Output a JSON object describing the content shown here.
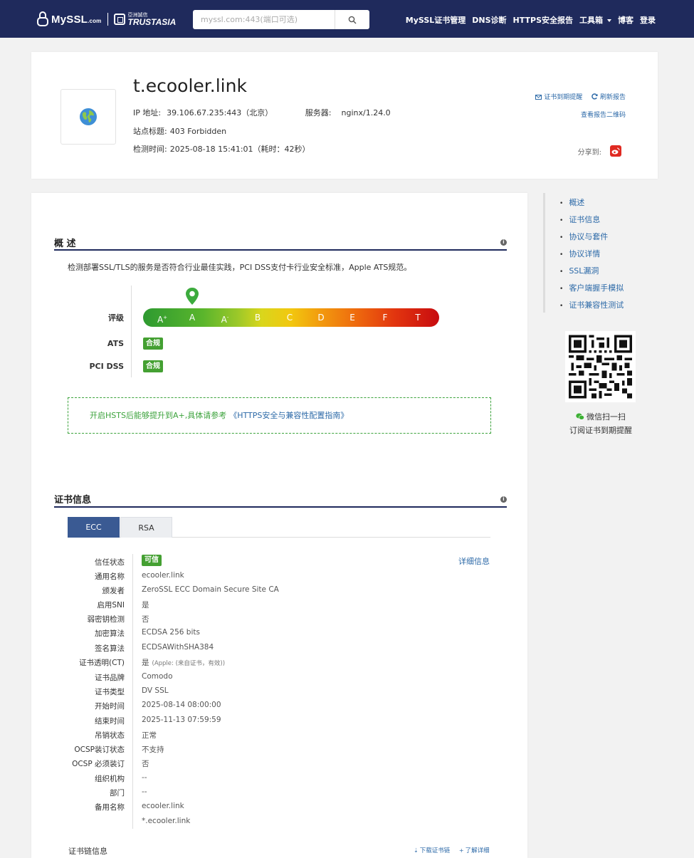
{
  "nav": {
    "brand": "MySSL",
    "brand_suffix": ".com",
    "partner_cn": "亞洲誠信",
    "partner_en": "TRUSTASIA",
    "search_placeholder": "myssl.com:443(端口可选)",
    "items": [
      "MySSL证书管理",
      "DNS诊断",
      "HTTPS安全报告",
      "工具箱",
      "博客",
      "登录"
    ]
  },
  "header": {
    "domain": "t.ecooler.link",
    "ip_label": "IP 地址:",
    "ip_value": "39.106.67.235:443（北京）",
    "server_label": "服务器:",
    "server_value": "nginx/1.24.0",
    "title_label": "站点标题:",
    "title_value": "403 Forbidden",
    "time_label": "检测时间:",
    "time_value": "2025-08-18 15:41:01（耗时：42秒）",
    "action_remind": "证书到期提醒",
    "action_refresh": "刷新报告",
    "action_qr": "查看报告二维码",
    "share_label": "分享到:"
  },
  "overview": {
    "title": "概 述",
    "desc": "检测部署SSL/TLS的服务是否符合行业最佳实践，PCI DSS支付卡行业安全标准，Apple ATS规范。",
    "grade_label": "评级",
    "grades": [
      "A",
      "A",
      "A",
      "B",
      "C",
      "D",
      "E",
      "F",
      "T"
    ],
    "grade_marks": [
      "+",
      "",
      "-",
      "",
      "",
      "",
      "",
      "",
      ""
    ],
    "current_grade": "A",
    "ats_label": "ATS",
    "ats_value": "合规",
    "pci_label": "PCI DSS",
    "pci_value": "合规",
    "hsts_text": "开启HSTS后能够提升到A+,具体请参考",
    "hsts_link": "《HTTPS安全与兼容性配置指南》",
    "colors": {
      "grade_ok": "#44a032",
      "nav_bg": "#1f2a5c",
      "link": "#2d6aa8"
    }
  },
  "cert": {
    "title": "证书信息",
    "tabs": [
      "ECC",
      "RSA"
    ],
    "active_tab": "ECC",
    "detail_link": "详细信息",
    "rows": [
      {
        "label": "信任状态",
        "value": "可信"
      },
      {
        "label": "通用名称",
        "value": "ecooler.link"
      },
      {
        "label": "颁发者",
        "value": "ZeroSSL ECC Domain Secure Site CA"
      },
      {
        "label": "启用SNI",
        "value": "是"
      },
      {
        "label": "弱密钥检测",
        "value": "否"
      },
      {
        "label": "加密算法",
        "value": "ECDSA 256 bits"
      },
      {
        "label": "签名算法",
        "value": "ECDSAWithSHA384"
      },
      {
        "label": "证书透明(CT)",
        "value": "是",
        "note": "(Apple: (来自证书，有效))"
      },
      {
        "label": "证书品牌",
        "value": "Comodo"
      },
      {
        "label": "证书类型",
        "value": "DV SSL"
      },
      {
        "label": "开始时间",
        "value": "2025-08-14 08:00:00"
      },
      {
        "label": "结束时间",
        "value": "2025-11-13 07:59:59"
      },
      {
        "label": "吊销状态",
        "value": "正常"
      },
      {
        "label": "OCSP装订状态",
        "value": "不支持"
      },
      {
        "label": "OCSP 必须装订",
        "value": "否"
      },
      {
        "label": "组织机构",
        "value": "--"
      },
      {
        "label": "部门",
        "value": "--"
      },
      {
        "label": "备用名称",
        "value": "ecooler.link"
      }
    ],
    "alt_name_2": "*.ecooler.link",
    "chain_title": "证书链信息",
    "chain_download": "下载证书链",
    "chain_learn": "了解详细"
  },
  "sidebar": {
    "items": [
      "概述",
      "证书信息",
      "协议与套件",
      "协议详情",
      "SSL漏洞",
      "客户端握手模拟",
      "证书兼容性测试"
    ],
    "qr_caption1": "微信扫一扫",
    "qr_caption2": "订阅证书到期提醒"
  }
}
